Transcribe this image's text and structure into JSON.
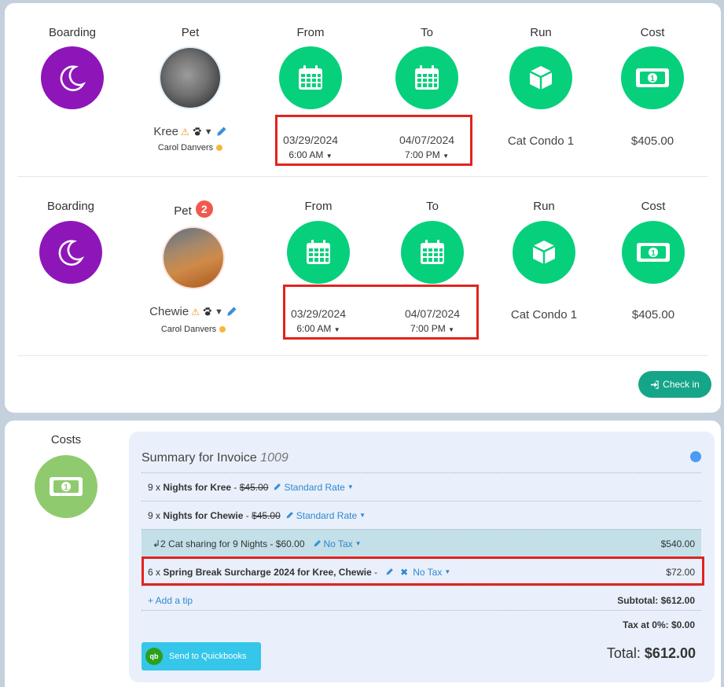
{
  "booking1": {
    "headers": {
      "boarding": "Boarding",
      "pet": "Pet",
      "from": "From",
      "to": "To",
      "run": "Run",
      "cost": "Cost"
    },
    "pet_name": "Kree",
    "owner": "Carol Danvers",
    "from_date": "03/29/2024",
    "from_time": "6:00 AM",
    "to_date": "04/07/2024",
    "to_time": "7:00 PM",
    "run": "Cat Condo 1",
    "cost": "$405.00"
  },
  "booking2": {
    "headers": {
      "boarding": "Boarding",
      "pet": "Pet",
      "from": "From",
      "to": "To",
      "run": "Run",
      "cost": "Cost"
    },
    "pet_badge": "2",
    "pet_name": "Chewie",
    "owner": "Carol Danvers",
    "from_date": "03/29/2024",
    "from_time": "6:00 AM",
    "to_date": "04/07/2024",
    "to_time": "7:00 PM",
    "run": "Cat Condo 1",
    "cost": "$405.00"
  },
  "checkin_label": "Check in",
  "costs": {
    "label": "Costs",
    "title": "Summary for Invoice",
    "invoice_number": "1009",
    "lines": [
      {
        "qty": "9 x",
        "name": "Nights for Kree",
        "sep": "-",
        "price": "$45.00",
        "rate": "Standard Rate"
      },
      {
        "qty": "9 x",
        "name": "Nights for Chewie",
        "sep": "-",
        "price": "$45.00",
        "rate": "Standard Rate"
      }
    ],
    "sharing": {
      "text": "↲2 Cat sharing for 9 Nights - $60.00",
      "tax": "No Tax",
      "amount": "$540.00"
    },
    "surcharge": {
      "qty": "6 x",
      "name": "Spring Break Surcharge 2024 for Kree, Chewie",
      "sep": "-",
      "tax": "No Tax",
      "amount": "$72.00"
    },
    "add_tip": "+ Add a tip",
    "subtotal": "Subtotal: $612.00",
    "tax": "Tax at 0%: $0.00",
    "total_label": "Total:",
    "total_value": "$612.00",
    "quickbooks_label": "Send to Quickbooks",
    "quickbooks_icon": "qb"
  },
  "colors": {
    "boarding": "#8e16b9",
    "action": "#07d07c",
    "costs": "#8fcb6e",
    "highlight": "#e1231f",
    "checkin": "#15a589"
  }
}
